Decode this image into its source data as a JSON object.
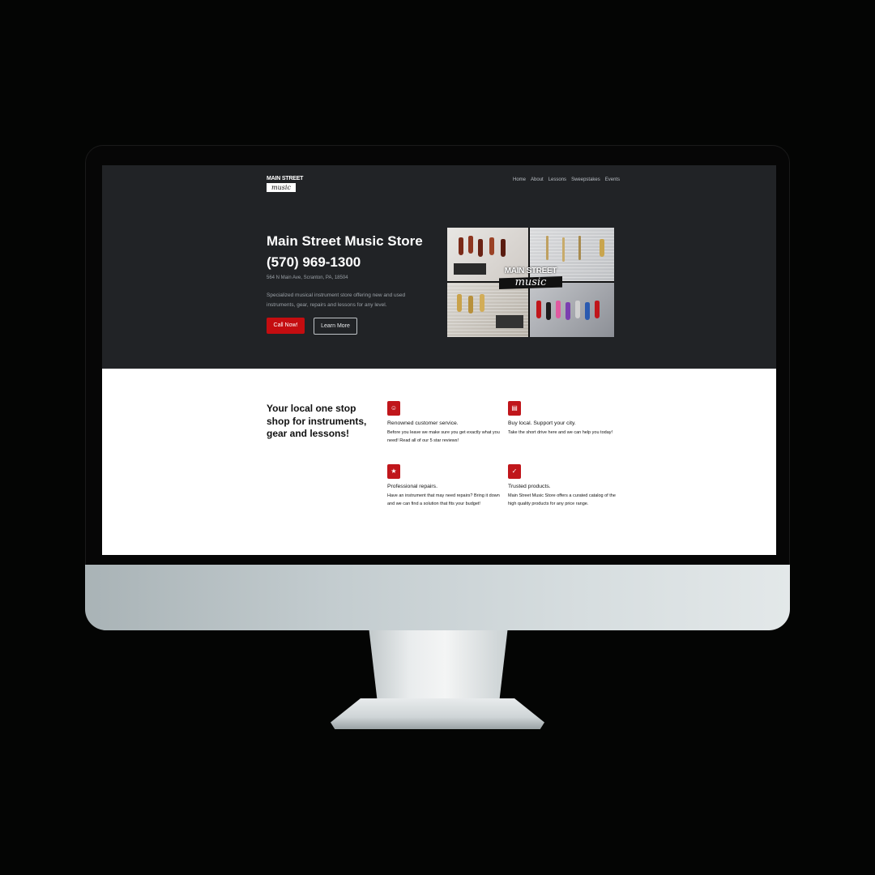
{
  "logo": {
    "top": "MAIN STREET",
    "bottom": "music"
  },
  "nav": [
    "Home",
    "About",
    "Lessons",
    "Sweepstakes",
    "Events"
  ],
  "hero": {
    "title": "Main Street Music Store",
    "phone": "(570) 969-1300",
    "address": "564 N Main Ave, Scranton, PA, 18504",
    "description": "Specialized musical instrument store offering new and used instruments, gear, repairs and lessons for any level.",
    "cta_primary": "Call Now!",
    "cta_secondary": "Learn More",
    "image_logo_top": "MAIN STREET",
    "image_logo_bottom": "music"
  },
  "features": {
    "title": "Your local one stop shop for instruments, gear and lessons!",
    "items": [
      {
        "icon": "people-icon",
        "title": "Renowned customer service.",
        "desc": "Before you leave we make sure you get exactly what you need! Read all of our 5 star reviews!"
      },
      {
        "icon": "chart-icon",
        "title": "Buy local. Support your city.",
        "desc": "Take the short drive here and we can help you today!"
      },
      {
        "icon": "star-icon",
        "title": "Professional repairs.",
        "desc": "Have an instrument that may need repairs? Bring it down and we can find a solution that fits your budget!"
      },
      {
        "icon": "check-icon",
        "title": "Trusted products.",
        "desc": "Main Street Music Store offers a curated catalog of the high quality products for any price range."
      }
    ]
  },
  "colors": {
    "hero_bg": "#212326",
    "accent": "#c40d10",
    "page_bg": "#040504"
  }
}
